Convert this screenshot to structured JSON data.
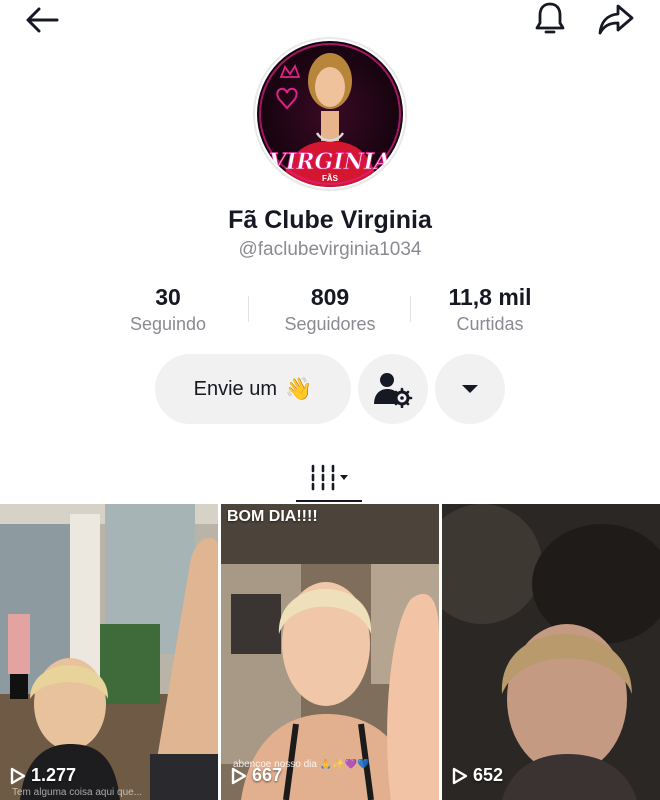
{
  "profile": {
    "display_name": "Fã Clube Virginia",
    "username": "@faclubevirginia1034",
    "avatar_logo_text": "VIRGINIA",
    "avatar_logo_sub": "FÃS"
  },
  "stats": [
    {
      "value": "30",
      "label": "Seguindo"
    },
    {
      "value": "809",
      "label": "Seguidores"
    },
    {
      "value": "11,8 mil",
      "label": "Curtidas"
    }
  ],
  "actions": {
    "message_label": "Envie um",
    "message_emoji": "👋"
  },
  "icons": {
    "back": "arrow-left-icon",
    "notifications": "bell-icon",
    "share": "share-arrow-icon",
    "add_friend": "person-gear-icon",
    "more": "caret-down-icon",
    "videos_tab": "grid-bars-icon",
    "play": "play-outline-icon"
  },
  "videos": [
    {
      "views": "1.277",
      "caption": "",
      "overlay_text": "",
      "overlay_bottom": "Tem alguma coisa aqui que..."
    },
    {
      "views": "667",
      "caption": "BOM DIA!!!!",
      "overlay_text": "abençoe nosso dia 🙏✨💜💙",
      "overlay_bottom": ""
    },
    {
      "views": "652",
      "caption": "",
      "overlay_text": "",
      "overlay_bottom": ""
    }
  ],
  "colors": {
    "text_primary": "#161823",
    "text_secondary": "#8a8b91",
    "button_bg": "#f1f1f2",
    "avatar_accent": "#e0218a"
  }
}
